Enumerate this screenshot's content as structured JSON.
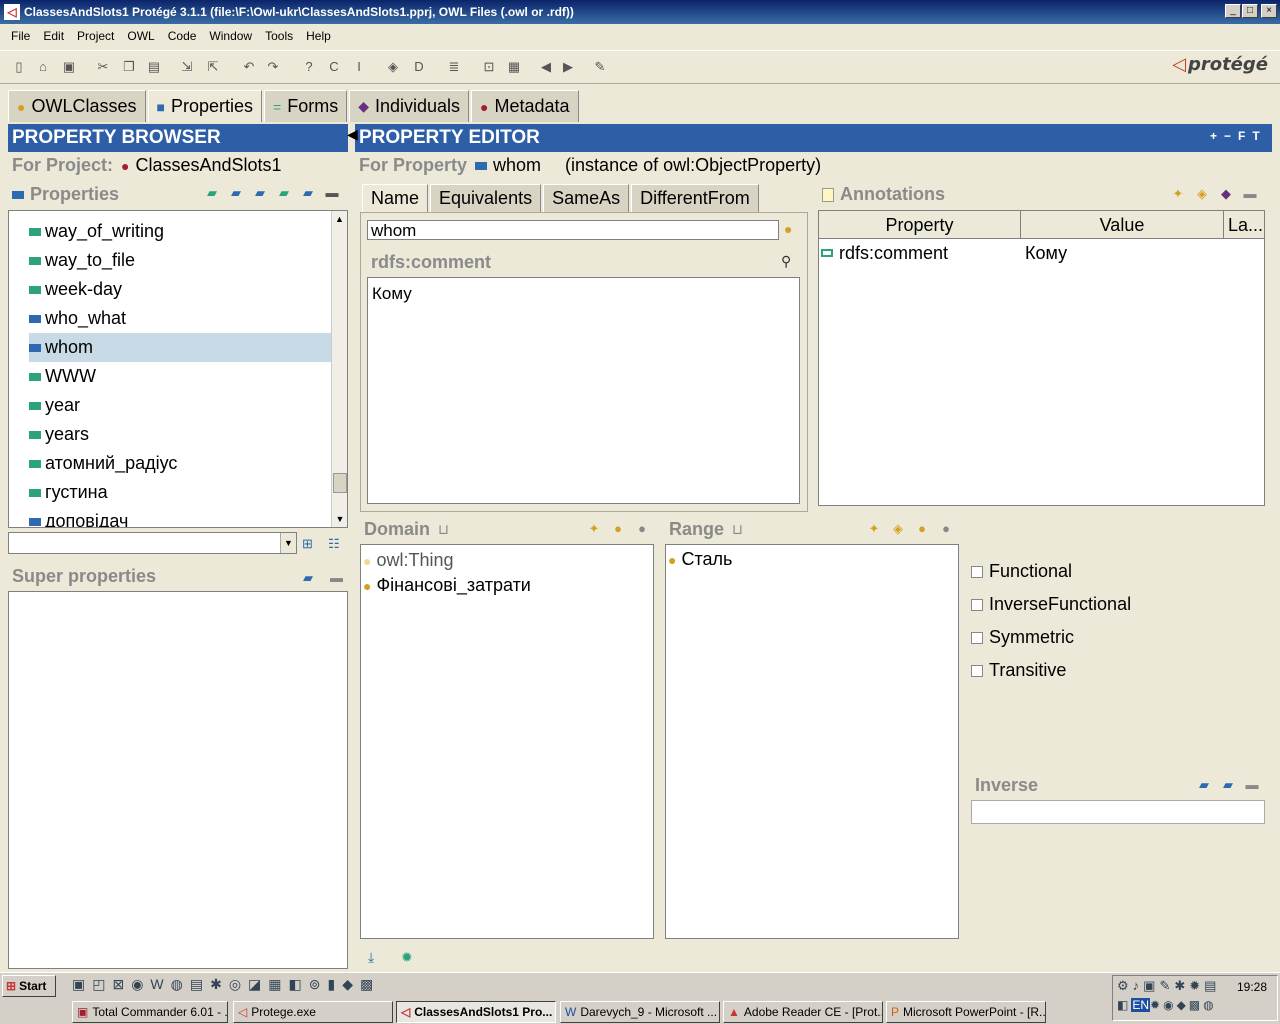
{
  "window": {
    "title": "ClassesAndSlots1  Protégé 3.1.1     (file:\\F:\\Owl-ukr\\ClassesAndSlots1.pprj, OWL Files (.owl or .rdf))"
  },
  "menu": [
    "File",
    "Edit",
    "Project",
    "OWL",
    "Code",
    "Window",
    "Tools",
    "Help"
  ],
  "logo_text": "protégé",
  "tabs": [
    {
      "label": "OWLClasses",
      "icon_color": "#d4a020"
    },
    {
      "label": "Properties",
      "icon_color": "#2e6ab0"
    },
    {
      "label": "Forms",
      "icon_color": "#2ea37a"
    },
    {
      "label": "Individuals",
      "icon_color": "#6a2e80"
    },
    {
      "label": "Metadata",
      "icon_color": "#a02030"
    }
  ],
  "browser": {
    "header": "PROPERTY BROWSER",
    "project_label": "For Project:",
    "project_name": "ClassesAndSlots1",
    "properties_label": "Properties",
    "items": [
      {
        "label": "way_of_writing",
        "kind": "datatype"
      },
      {
        "label": "way_to_file",
        "kind": "datatype"
      },
      {
        "label": "week-day",
        "kind": "datatype"
      },
      {
        "label": "who_what",
        "kind": "object"
      },
      {
        "label": "whom",
        "kind": "object",
        "selected": true
      },
      {
        "label": "WWW",
        "kind": "datatype"
      },
      {
        "label": "year",
        "kind": "datatype"
      },
      {
        "label": "years",
        "kind": "datatype"
      },
      {
        "label": "атомний_радіус",
        "kind": "datatype"
      },
      {
        "label": "густина",
        "kind": "datatype"
      },
      {
        "label": "доповідач",
        "kind": "object"
      }
    ],
    "search_value": "",
    "super_properties_label": "Super properties"
  },
  "editor": {
    "header": "PROPERTY EDITOR",
    "header_buttons": [
      "+",
      "−",
      "F",
      "T"
    ],
    "for_property_label": "For Property",
    "property_name": "whom",
    "instance_text": "(instance of owl:ObjectProperty)",
    "subtabs": [
      "Name",
      "Equivalents",
      "SameAs",
      "DifferentFrom"
    ],
    "name_value": "whom",
    "comment_label": "rdfs:comment",
    "comment_text": "Кому",
    "annotations": {
      "label": "Annotations",
      "columns": [
        "Property",
        "Value",
        "La..."
      ],
      "rows": [
        {
          "property": "rdfs:comment",
          "value": "Кому",
          "lang": ""
        }
      ]
    },
    "domain": {
      "label": "Domain",
      "items": [
        {
          "label": "owl:Thing",
          "color": "#f0d890"
        },
        {
          "label": "Фінансові_затрати",
          "color": "#d4a020"
        }
      ]
    },
    "range": {
      "label": "Range",
      "items": [
        {
          "label": "Сталь",
          "color": "#d4a020"
        }
      ]
    },
    "characteristics": [
      {
        "label": "Functional",
        "checked": false
      },
      {
        "label": "InverseFunctional",
        "checked": false
      },
      {
        "label": "Symmetric",
        "checked": false
      },
      {
        "label": "Transitive",
        "checked": false
      }
    ],
    "inverse_label": "Inverse",
    "inverse_value": ""
  },
  "taskbar": {
    "start": "Start",
    "time": "19:28",
    "tasks": [
      {
        "label": "Total Commander 6.01 - ...",
        "active": false
      },
      {
        "label": "Protege.exe",
        "active": false
      },
      {
        "label": "ClassesAndSlots1  Pro...",
        "active": true
      },
      {
        "label": "Darevych_9 - Microsoft ...",
        "active": false
      },
      {
        "label": "Adobe Reader CE - [Prot...",
        "active": false
      },
      {
        "label": "Microsoft PowerPoint - [R...",
        "active": false
      }
    ]
  }
}
